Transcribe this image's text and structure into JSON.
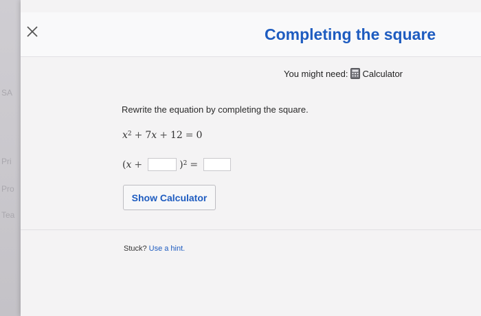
{
  "backdrop": {
    "fragments": [
      "SA",
      "Pri",
      "Pro",
      "Tea"
    ]
  },
  "dialog": {
    "title": "Completing the square",
    "close_icon": "close-icon",
    "might_need_label": "You might need:",
    "tool_name": "Calculator",
    "tool_icon": "calculator-icon"
  },
  "problem": {
    "prompt": "Rewrite the equation by completing the square.",
    "equation": {
      "x": "x",
      "exp": "2",
      "plus": "+",
      "coef": "7",
      "constant": "12",
      "equals": "=",
      "rhs": "0"
    },
    "answer_row": {
      "open_paren": "(",
      "x": "x",
      "plus": "+",
      "close_paren": ")",
      "exp": "2",
      "equals": "=",
      "box1_value": "",
      "box2_value": ""
    }
  },
  "actions": {
    "show_calculator": "Show Calculator"
  },
  "help": {
    "stuck_label": "Stuck?",
    "hint_link": "Use a hint."
  },
  "colors": {
    "accent": "#1e5cc0",
    "dialog_bg": "#f4f3f4"
  }
}
